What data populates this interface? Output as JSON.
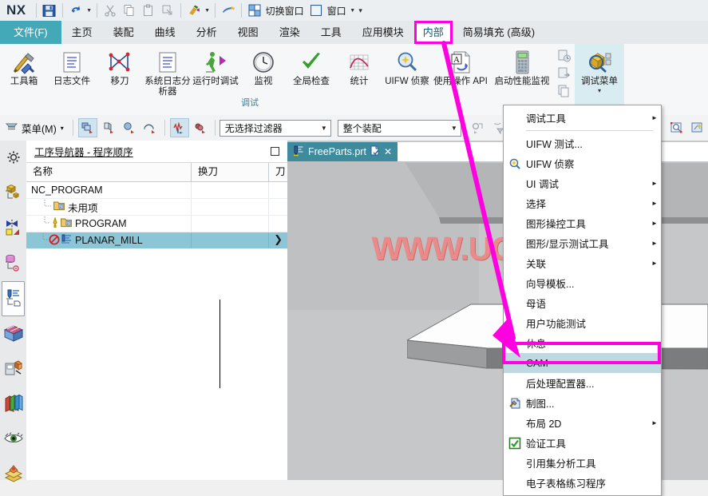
{
  "app": {
    "logo": "NX"
  },
  "quick_access": {
    "items": [
      {
        "name": "save-icon",
        "label": ""
      },
      {
        "name": "undo-icon",
        "label": ""
      },
      {
        "name": "cut-icon",
        "label": ""
      },
      {
        "name": "copy-icon",
        "label": ""
      },
      {
        "name": "paste-icon",
        "label": ""
      },
      {
        "name": "paste-special-icon",
        "label": ""
      },
      {
        "name": "paint-icon",
        "label": ""
      },
      {
        "name": "eraser-icon",
        "label": ""
      }
    ],
    "switch_window_label": "切换窗口",
    "window_label": "窗口",
    "more_label": "▾"
  },
  "tabs": [
    {
      "label": "文件(F)",
      "state": "file"
    },
    {
      "label": "主页",
      "state": "normal"
    },
    {
      "label": "装配",
      "state": "normal"
    },
    {
      "label": "曲线",
      "state": "normal"
    },
    {
      "label": "分析",
      "state": "normal"
    },
    {
      "label": "视图",
      "state": "normal"
    },
    {
      "label": "渲染",
      "state": "normal"
    },
    {
      "label": "工具",
      "state": "normal"
    },
    {
      "label": "应用模块",
      "state": "normal"
    },
    {
      "label": "内部",
      "state": "highlighted"
    },
    {
      "label": "简易填充 (高级)",
      "state": "normal"
    }
  ],
  "ribbon": {
    "group_caption": "调试",
    "buttons": [
      {
        "label": "工具箱",
        "icon": "toolbox-icon"
      },
      {
        "label": "日志文件",
        "icon": "log-file-icon"
      },
      {
        "label": "移刀",
        "icon": "move-tool-icon"
      },
      {
        "label": "系统日志分析器",
        "icon": "syslog-analyzer-icon"
      },
      {
        "label": "运行时调试",
        "icon": "runtime-debug-icon"
      },
      {
        "label": "监视",
        "icon": "monitor-clock-icon"
      },
      {
        "label": "全局检查",
        "icon": "global-check-icon"
      },
      {
        "label": "统计",
        "icon": "statistics-icon"
      },
      {
        "label": "UIFW 侦察",
        "icon": "uifw-scout-icon"
      },
      {
        "label": "使用操作 API",
        "icon": "operation-api-icon"
      },
      {
        "label": "启动性能监视",
        "icon": "startup-perf-icon"
      }
    ],
    "small_stack": [
      {
        "icon": "history-clock-icon"
      },
      {
        "icon": "export-page-icon"
      },
      {
        "icon": "copy-page-icon"
      }
    ],
    "debug_menu": {
      "label": "调试菜单",
      "caret": "▾",
      "icon": "debug-menu-icon"
    }
  },
  "selection_bar": {
    "menu_label": "菜单(M)",
    "menu_caret": "▾",
    "icons": [
      {
        "name": "select-general-icon",
        "active": true
      },
      {
        "name": "select-feature-icon",
        "active": false
      },
      {
        "name": "select-body-icon",
        "active": false
      },
      {
        "name": "select-edge-icon",
        "active": false
      },
      {
        "name": "select-curve-icon",
        "active": true
      },
      {
        "name": "select-face-icon",
        "active": false
      }
    ],
    "filter_combo": {
      "value": "无选择过滤器",
      "caret": "▼"
    },
    "scope_combo": {
      "value": "整个装配",
      "caret": "▼"
    },
    "right_icons": [
      {
        "name": "snap-point-icon"
      },
      {
        "name": "filter-funnel-icon"
      },
      {
        "name": "move-filter-icon"
      }
    ],
    "far_right_icons": [
      {
        "name": "zoom-window-icon"
      },
      {
        "name": "fit-view-icon"
      }
    ]
  },
  "rail": {
    "items": [
      {
        "name": "rail-item-settings",
        "icon": "gear-icon",
        "selected": false
      },
      {
        "name": "rail-item-assembly-navigator",
        "icon": "assembly-navigator-icon",
        "selected": false
      },
      {
        "name": "rail-item-constraint-navigator",
        "icon": "constraint-navigator-icon",
        "selected": false
      },
      {
        "name": "rail-item-part-navigator",
        "icon": "part-navigator-icon",
        "selected": false
      },
      {
        "name": "rail-item-operation-navigator",
        "icon": "operation-navigator-icon",
        "selected": true
      },
      {
        "name": "rail-item-reuse-library",
        "icon": "reuse-library-icon",
        "selected": false
      },
      {
        "name": "rail-item-cam-library",
        "icon": "cam-library-icon",
        "selected": false
      },
      {
        "name": "rail-item-books",
        "icon": "books-icon",
        "selected": false
      },
      {
        "name": "rail-item-view-eye",
        "icon": "eye-icon",
        "selected": false
      },
      {
        "name": "rail-item-history",
        "icon": "history-stack-icon",
        "selected": false
      }
    ]
  },
  "navigator": {
    "title": "工序导航器 - 程序顺序",
    "pin_icon": "□",
    "columns": [
      "名称",
      "换刀",
      "刀"
    ],
    "rows": [
      {
        "label": "NC_PROGRAM",
        "indent": 0,
        "status": "",
        "icon": "",
        "selected": false
      },
      {
        "label": "未用项",
        "indent": 1,
        "status": "",
        "icon": "folder-icon",
        "selected": false
      },
      {
        "label": "PROGRAM",
        "indent": 1,
        "status": "warning",
        "icon": "folder-icon",
        "selected": false
      },
      {
        "label": "PLANAR_MILL",
        "indent": 1,
        "status": "blocked",
        "icon": "planar-mill-icon",
        "selected": true
      }
    ],
    "row_expand_glyph": "❯"
  },
  "document_tab": {
    "title": "FreeParts.prt",
    "modified_icon": "modified-icon",
    "close_icon": "✕"
  },
  "graphics": {
    "watermark": "WWW.UGNX.NET"
  },
  "dropdown_menu": {
    "items": [
      {
        "label": "调试工具",
        "submenu": true,
        "icon": "",
        "highlighted": false
      },
      {
        "separator": true
      },
      {
        "label": "UIFW 测试...",
        "submenu": false,
        "icon": "",
        "highlighted": false
      },
      {
        "label": "UIFW 侦察",
        "submenu": false,
        "icon": "magnifier-icon",
        "highlighted": false
      },
      {
        "label": "UI 调试",
        "submenu": true,
        "icon": "",
        "highlighted": false
      },
      {
        "label": "选择",
        "submenu": true,
        "icon": "",
        "highlighted": false
      },
      {
        "label": "图形操控工具",
        "submenu": true,
        "icon": "",
        "highlighted": false
      },
      {
        "label": "图形/显示测试工具",
        "submenu": true,
        "icon": "",
        "highlighted": false
      },
      {
        "label": "关联",
        "submenu": true,
        "icon": "",
        "highlighted": false
      },
      {
        "label": "向导模板...",
        "submenu": false,
        "icon": "",
        "highlighted": false
      },
      {
        "label": "母语",
        "submenu": false,
        "icon": "",
        "highlighted": false
      },
      {
        "label": "用户功能测试",
        "submenu": false,
        "icon": "",
        "highlighted": false
      },
      {
        "label": "休息",
        "submenu": false,
        "icon": "",
        "highlighted": false
      },
      {
        "label": "CAM",
        "submenu": false,
        "icon": "",
        "highlighted": true
      },
      {
        "label": "后处理配置器...",
        "submenu": false,
        "icon": "",
        "highlighted": false
      },
      {
        "label": "制图...",
        "submenu": false,
        "icon": "drafting-icon",
        "highlighted": false
      },
      {
        "label": "布局 2D",
        "submenu": true,
        "icon": "",
        "highlighted": false
      },
      {
        "label": "验证工具",
        "submenu": false,
        "icon": "check-green-icon",
        "highlighted": false
      },
      {
        "label": "引用集分析工具",
        "submenu": false,
        "icon": "",
        "highlighted": false
      },
      {
        "label": "电子表格练习程序",
        "submenu": false,
        "icon": "",
        "highlighted": false
      }
    ],
    "submenu_arrow": "►"
  },
  "annotations": {
    "highlight_color": "#ff00e0",
    "tab_highlight": "内部",
    "menu_item_highlight": "CAM",
    "arrow": "magenta-arrow"
  },
  "colors": {
    "accent_teal": "#43a8b8",
    "highlight_pink": "#ff00e0",
    "selection_blue": "#8cc6d6",
    "menu_highlight": "#bfd9e0",
    "ribbon_bg": "#f6f7f8",
    "graphics_bg": "#c6c7c8",
    "watermark": "#e98b8b"
  }
}
